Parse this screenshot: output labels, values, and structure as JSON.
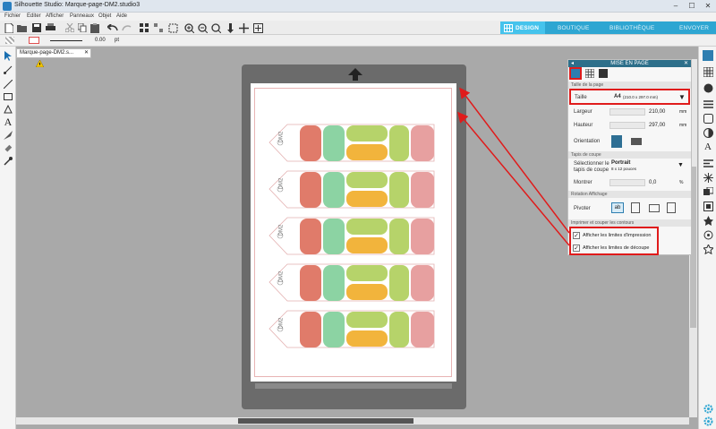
{
  "window": {
    "title": "Silhouette Studio: Marque-page-DM2.studio3"
  },
  "menu": [
    "Fichier",
    "Editer",
    "Afficher",
    "Panneaux",
    "Objet",
    "Aide"
  ],
  "nav": {
    "design": "DESIGN",
    "boutique": "BOUTIQUE",
    "bibliotheque": "BIBLIOTHÈQUE",
    "envoyer": "ENVOYER"
  },
  "linebar": {
    "width_value": "0.00",
    "width_unit": "pt"
  },
  "document": {
    "tab": "Marque-page-DM2.s..."
  },
  "bookmark": {
    "label": "DM2"
  },
  "panel": {
    "title": "MISE EN PAGE",
    "sec_page": "Taille de la page",
    "size_label": "Taille",
    "size_value": "A4",
    "size_sub": "(210.0 x 297.0 mm)",
    "width_label": "Largeur",
    "width_value": "210,00",
    "height_label": "Hauteur",
    "height_value": "297,00",
    "unit": "mm",
    "orientation_label": "Orientation",
    "sec_mat": "Tapis de coupe",
    "mat_label": "Sélectionner le tapis de coupe",
    "mat_value": "Portrait",
    "mat_sub": "8 x 12 pouces",
    "show_label": "Montrer",
    "show_value": "0,0",
    "show_unit": "%",
    "sec_rotation": "Rotation Affichage",
    "rotate_label": "Pivoter",
    "sec_print": "Imprimer et couper les contours",
    "print_limits": "Afficher les limites d'impression",
    "cut_limits": "Afficher les limites de découpe"
  },
  "colors": {
    "accent": "#2ea6d2",
    "highlight": "#e01b1b",
    "panel_header": "#2d6f8a"
  }
}
